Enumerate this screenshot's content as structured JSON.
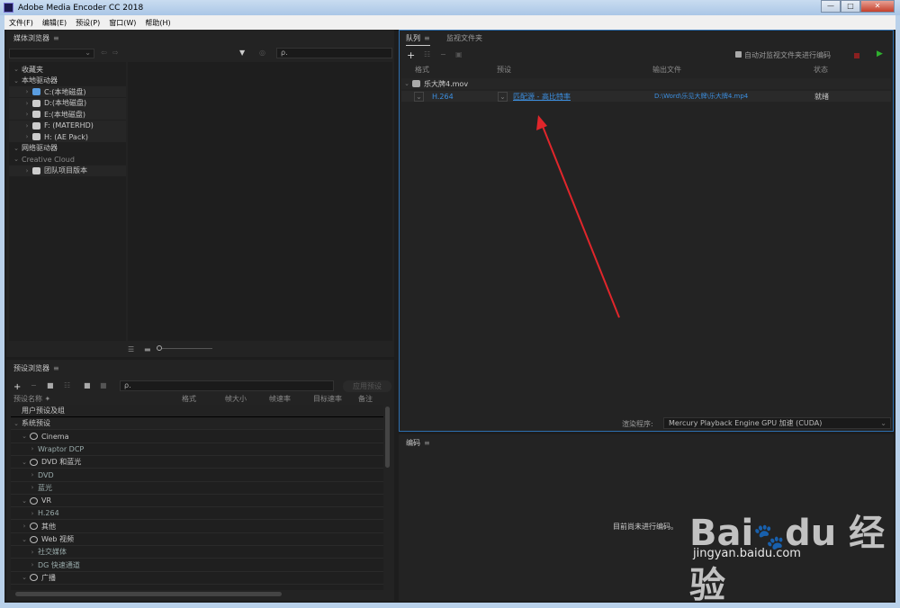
{
  "window": {
    "title": "Adobe Media Encoder CC 2018",
    "minimize": "—",
    "maximize": "□",
    "close": "✕"
  },
  "menu": [
    "文件(F)",
    "编辑(E)",
    "预设(P)",
    "窗口(W)",
    "帮助(H)"
  ],
  "media_browser": {
    "title": "媒体浏览器",
    "search_placeholder": "ρ.",
    "tree": [
      {
        "label": "收藏夹",
        "level": 0,
        "expanded": true
      },
      {
        "label": "本地驱动器",
        "level": 0,
        "expanded": true
      },
      {
        "label": "C:(本地磁盘)",
        "level": 1,
        "icon": "windows-drive-icon"
      },
      {
        "label": "D:(本地磁盘)",
        "level": 1,
        "icon": "drive-icon"
      },
      {
        "label": "E:(本地磁盘)",
        "level": 1,
        "icon": "drive-icon"
      },
      {
        "label": "F: (MATERHD)",
        "level": 1,
        "icon": "removable-drive-icon"
      },
      {
        "label": "H: (AE Pack)",
        "level": 1,
        "icon": "disc-icon"
      },
      {
        "label": "网络驱动器",
        "level": 0,
        "expanded": true
      },
      {
        "label": "Creative Cloud",
        "level": 0,
        "expanded": true
      },
      {
        "label": "团队项目版本",
        "level": 1,
        "icon": "team-project-icon"
      }
    ]
  },
  "preset_browser": {
    "title": "预设浏览器",
    "apply_button": "应用预设",
    "search_placeholder": "ρ.",
    "columns": [
      "预设名称 ✦",
      "格式",
      "帧大小",
      "帧速率",
      "目标速率",
      "备注"
    ],
    "tree": [
      {
        "label": "用户预设及组",
        "level": 0,
        "chev": ""
      },
      {
        "label": "系统预设",
        "level": 0,
        "chev": "⌄"
      },
      {
        "label": "Cinema",
        "level": 1,
        "chev": "⌄",
        "icon": "cinema-icon"
      },
      {
        "label": "Wraptor DCP",
        "level": 2,
        "chev": "›"
      },
      {
        "label": "DVD 和蓝光",
        "level": 1,
        "chev": "⌄",
        "icon": "disc-icon"
      },
      {
        "label": "DVD",
        "level": 2,
        "chev": "›"
      },
      {
        "label": "蓝光",
        "level": 2,
        "chev": "›"
      },
      {
        "label": "VR",
        "level": 1,
        "chev": "⌄",
        "icon": "vr-icon"
      },
      {
        "label": "H.264",
        "level": 2,
        "chev": "›"
      },
      {
        "label": "其他",
        "level": 1,
        "chev": "›",
        "icon": "monitor-icon"
      },
      {
        "label": "Web 视频",
        "level": 1,
        "chev": "⌄",
        "icon": "globe-icon"
      },
      {
        "label": "社交媒体",
        "level": 2,
        "chev": "›"
      },
      {
        "label": "DG 快速通道",
        "level": 2,
        "chev": "›"
      },
      {
        "label": "广播",
        "level": 1,
        "chev": "⌄",
        "icon": "tv-icon"
      }
    ]
  },
  "queue": {
    "tabs": [
      "队列",
      "监视文件夹"
    ],
    "auto_encode_label": "自动对监视文件夹进行编码",
    "columns": [
      "格式",
      "预设",
      "输出文件",
      "状态"
    ],
    "source": "乐大牌4.mov",
    "item": {
      "format": "H.264",
      "preset": "匹配源 - 高比特率",
      "output": "D:\\Word\\乐见大牌\\乐大牌4.mp4",
      "status": "就绪"
    },
    "renderer_label": "渲染程序:",
    "renderer_value": "Mercury Playback Engine GPU 加速 (CUDA)"
  },
  "encoding": {
    "title": "编码",
    "empty_message": "目前尚未进行编码。"
  },
  "watermark": {
    "logo": "Bai du 经验",
    "url": "jingyan.baidu.com"
  },
  "colors": {
    "accent": "#3c8fe0",
    "arrow": "#e0262b",
    "play": "#2fb12f",
    "stop": "#8a2020"
  }
}
